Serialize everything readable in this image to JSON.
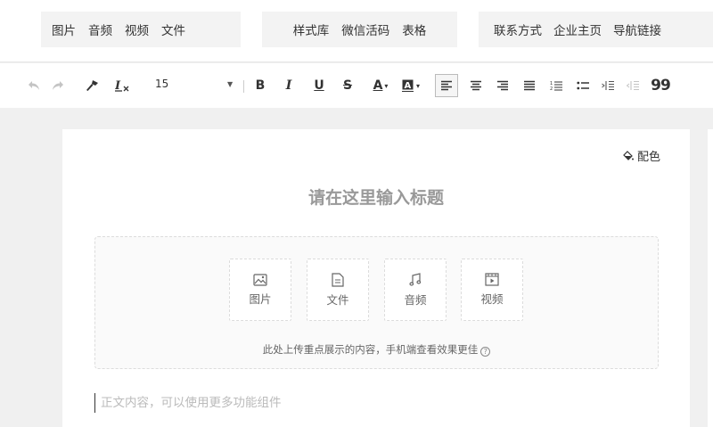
{
  "insert_bar": {
    "group1": [
      "图片",
      "音频",
      "视频",
      "文件"
    ],
    "group2": [
      "样式库",
      "微信活码",
      "表格"
    ],
    "group3": [
      "联系方式",
      "企业主页",
      "导航链接"
    ]
  },
  "toolbar": {
    "font_size": "15",
    "bold": "B",
    "italic": "I",
    "underline": "U",
    "strike": "S",
    "font_color": "A",
    "quote": "99"
  },
  "editor": {
    "color_button": "配色",
    "title_placeholder": "请在这里输入标题",
    "upload_buttons": [
      "图片",
      "文件",
      "音频",
      "视频"
    ],
    "upload_hint": "此处上传重点展示的内容，手机端查看效果更佳",
    "body_placeholder": "正文内容，可以使用更多功能组件"
  },
  "colors": {
    "background": "#f0f0f0",
    "group_bg": "#f3f3f3",
    "title_gray": "#999999"
  }
}
